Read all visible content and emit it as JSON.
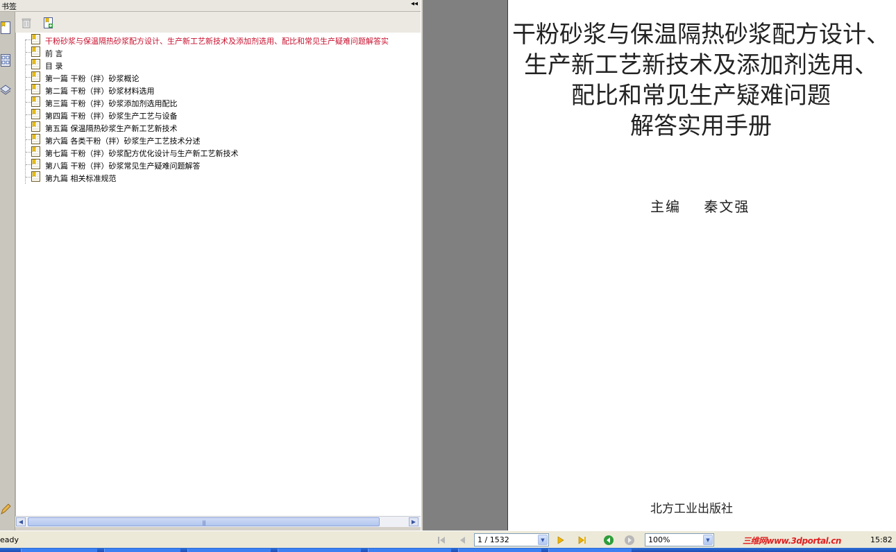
{
  "panel": {
    "title": "书签",
    "collapse_glyph": "◂◂"
  },
  "bookmarks": [
    {
      "label": "干粉砂浆与保温隔热砂浆配方设计、生产新工艺新技术及添加剂选用、配比和常见生产疑难问题解答实",
      "selected": true
    },
    {
      "label": "前 言",
      "selected": false
    },
    {
      "label": "目 录",
      "selected": false
    },
    {
      "label": "第一篇  干粉（拌）砂浆概论",
      "selected": false
    },
    {
      "label": "第二篇  干粉（拌）砂浆材料选用",
      "selected": false
    },
    {
      "label": "第三篇  干粉（拌）砂浆添加剂选用配比",
      "selected": false
    },
    {
      "label": "第四篇  干粉（拌）砂浆生产工艺与设备",
      "selected": false
    },
    {
      "label": "第五篇  保温隔热砂浆生产新工艺新技术",
      "selected": false
    },
    {
      "label": "第六篇  各类干粉（拌）砂浆生产工艺技术分述",
      "selected": false
    },
    {
      "label": "第七篇  干粉（拌）砂浆配方优化设计与生产新工艺新技术",
      "selected": false
    },
    {
      "label": "第八篇  干粉（拌）砂浆常见生产疑难问题解答",
      "selected": false
    },
    {
      "label": "第九篇  相关标准规范",
      "selected": false
    }
  ],
  "document": {
    "title_lines": [
      "干粉砂浆与保温隔热砂浆配方设计、",
      "生产新工艺新技术及添加剂选用、",
      "配比和常见生产疑难问题",
      "解答实用手册"
    ],
    "editor": "主编    秦文强",
    "publisher": "北方工业出版社"
  },
  "statusbar": {
    "status": "eady",
    "page_display": "1 / 1532",
    "zoom": "100%",
    "time": "15:82",
    "watermark": "三维网www.3dportal.cn"
  },
  "colors": {
    "selected_bookmark": "#c8102e",
    "doc_background": "#808080",
    "nav_green": "#2e9d3a"
  }
}
